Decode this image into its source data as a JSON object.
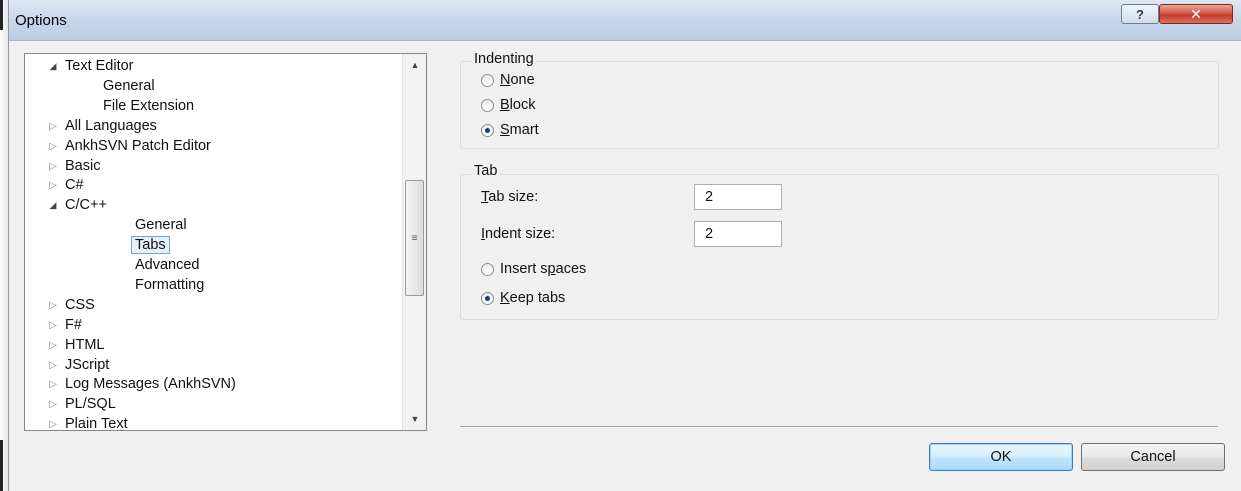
{
  "window": {
    "title": "Options",
    "help_glyph": "?",
    "close_glyph": "✕"
  },
  "tree": {
    "items": [
      {
        "label": "Text Editor",
        "state": "open",
        "level": 0
      },
      {
        "label": "General",
        "state": "none",
        "level": 1
      },
      {
        "label": "File Extension",
        "state": "none",
        "level": 1
      },
      {
        "label": "All Languages",
        "state": "closed",
        "level": 0
      },
      {
        "label": "AnkhSVN Patch Editor",
        "state": "closed",
        "level": 0
      },
      {
        "label": "Basic",
        "state": "closed",
        "level": 0
      },
      {
        "label": "C#",
        "state": "closed",
        "level": 0
      },
      {
        "label": "C/C++",
        "state": "open",
        "level": 0
      },
      {
        "label": "General",
        "state": "none",
        "level": 2
      },
      {
        "label": "Tabs",
        "state": "none",
        "level": 2,
        "selected": true
      },
      {
        "label": "Advanced",
        "state": "none",
        "level": 2
      },
      {
        "label": "Formatting",
        "state": "none",
        "level": 2
      },
      {
        "label": "CSS",
        "state": "closed",
        "level": 0
      },
      {
        "label": "F#",
        "state": "closed",
        "level": 0
      },
      {
        "label": "HTML",
        "state": "closed",
        "level": 0
      },
      {
        "label": "JScript",
        "state": "closed",
        "level": 0
      },
      {
        "label": "Log Messages (AnkhSVN)",
        "state": "closed",
        "level": 0
      },
      {
        "label": "PL/SQL",
        "state": "closed",
        "level": 0
      },
      {
        "label": "Plain Text",
        "state": "closed",
        "level": 0
      }
    ]
  },
  "indenting": {
    "title": "Indenting",
    "options": [
      {
        "key": "N",
        "rest": "one",
        "selected": false
      },
      {
        "key": "B",
        "rest": "lock",
        "selected": false
      },
      {
        "key": "S",
        "rest": "mart",
        "selected": true
      }
    ]
  },
  "tab": {
    "title": "Tab",
    "tab_size_key": "T",
    "tab_size_rest": "ab size:",
    "tab_size_value": "2",
    "indent_size_key": "I",
    "indent_size_rest": "ndent size:",
    "indent_size_value": "2",
    "insert_spaces_pre": "Insert s",
    "insert_spaces_key": "p",
    "insert_spaces_post": "aces",
    "insert_spaces_selected": false,
    "keep_tabs_key": "K",
    "keep_tabs_rest": "eep tabs",
    "keep_tabs_selected": true
  },
  "buttons": {
    "ok": "OK",
    "cancel": "Cancel"
  }
}
